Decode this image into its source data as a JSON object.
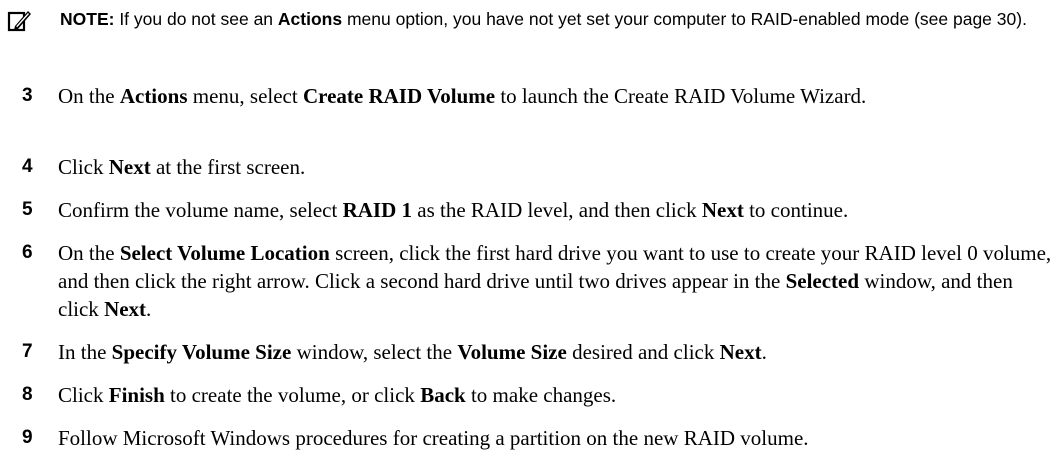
{
  "note": {
    "icon": "pencil-note-icon",
    "label": "NOTE:",
    "segments": [
      " If you do not see an ",
      "Actions",
      " menu option, you have not yet set your computer to RAID-enabled mode (see page 30)."
    ]
  },
  "steps": [
    {
      "number": "3",
      "segments": [
        "On the ",
        "Actions",
        " menu, select ",
        "Create RAID Volume",
        " to launch the Create RAID Volume Wizard."
      ]
    },
    {
      "number": "4",
      "segments": [
        "Click ",
        "Next",
        " at the first screen."
      ]
    },
    {
      "number": "5",
      "segments": [
        "Confirm the volume name, select ",
        "RAID 1",
        " as the RAID level, and then click ",
        "Next",
        " to continue."
      ]
    },
    {
      "number": "6",
      "segments": [
        "On the ",
        "Select Volume Location",
        " screen, click the first hard drive you want to use to create your RAID level 0 volume, and then click the right arrow. Click a second hard drive until two drives appear in the ",
        "Selected",
        " window, and then click ",
        "Next",
        "."
      ]
    },
    {
      "number": "7",
      "segments": [
        "In the ",
        "Specify Volume Size",
        " window, select the ",
        "Volume Size",
        " desired and click ",
        "Next",
        "."
      ]
    },
    {
      "number": "8",
      "segments": [
        "Click ",
        "Finish",
        " to create the volume, or click ",
        "Back",
        " to make changes."
      ]
    },
    {
      "number": "9",
      "segments": [
        "Follow Microsoft Windows procedures for creating a partition on the new RAID volume."
      ]
    }
  ]
}
